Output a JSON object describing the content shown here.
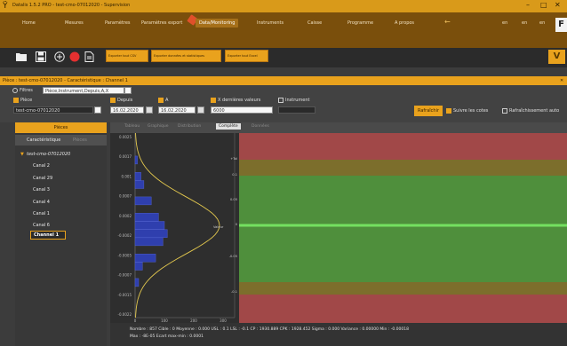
{
  "window": {
    "title": "Datalis 1.5.2 PRO - test-cmo-07012020 - Supervision",
    "minimize": "–",
    "maximize": "□",
    "close": "✕"
  },
  "menu": {
    "items": [
      "Home",
      "Mesures",
      "Paramètres",
      "Paramètres export",
      "Data/Monitoring",
      "Instruments",
      "Caisse",
      "Programme",
      "A propos"
    ],
    "active": "Data/Monitoring",
    "right_items": [
      "en",
      "en",
      "en"
    ],
    "arrow": "←",
    "fat_icon": "F"
  },
  "toolbar": {
    "export_buttons": [
      "Exporter tout CSV",
      "Exporter données et statistiques",
      "Exporter tout Excel"
    ],
    "corner_glyph": "V"
  },
  "panel": {
    "title": "Pièce : test-cmo-07012020 - Caractéristique : Channel 1",
    "close": "✕"
  },
  "filters": {
    "label": "Filtres",
    "value": "Pièce,Instrument,Depuis,A,X",
    "piece_label": "Pièce",
    "piece_value": "test-cmo-07012020",
    "depuis_label": "Depuis",
    "depuis_value": "16.02.2020",
    "a_label": "A",
    "a_value": "16.02.2020",
    "x_label": "X dernières valeurs",
    "x_value": "6000",
    "instrument_label": "Instrument",
    "refresh_label": "Rafraîchir",
    "follow_label": "Suivre les cotes",
    "auto_label": "Rafraîchissement auto"
  },
  "tree": {
    "tab_active": "Pièces",
    "subtab_active": "Caractéristique",
    "subtab_inactive": "Pièces",
    "root": "test-cmo-07012020",
    "items": [
      "Canal 2",
      "Canal 29",
      "Canal 3",
      "Canal 4",
      "Canal 1",
      "Canal 6"
    ],
    "selected": "Channel 1"
  },
  "view_tabs": {
    "items": [
      "Tableau",
      "Graphique",
      "Distribution",
      "Complète",
      "Données"
    ],
    "active": "Complète"
  },
  "chart_data": {
    "type": "histogram",
    "y_ticks": [
      "0.0025",
      "0.0017",
      "0.001",
      "0.0007",
      "0.0002",
      "-0.0002",
      "-0.0005",
      "-0.0007",
      "-0.0015",
      "-0.0022"
    ],
    "x_ticks": [
      "0",
      "100",
      "200",
      "300"
    ],
    "control_limits": [
      "+Tol",
      "0.1",
      "0.05",
      "0",
      "-0.05",
      "-0.1"
    ],
    "center_tag": "Valeur",
    "bins": [
      {
        "y": -0.0007,
        "count": 12
      },
      {
        "y": -0.0005,
        "count": 25
      },
      {
        "y": -0.0004,
        "count": 70
      },
      {
        "y": -0.0002,
        "count": 95
      },
      {
        "y": -0.0001,
        "count": 110
      },
      {
        "y": 0.0,
        "count": 100
      },
      {
        "y": 0.0001,
        "count": 80
      },
      {
        "y": 0.0003,
        "count": 55
      },
      {
        "y": 0.0005,
        "count": 30
      },
      {
        "y": 0.0006,
        "count": 20
      },
      {
        "y": 0.0008,
        "count": 8
      }
    ],
    "bands": {
      "colors": {
        "red": "#a14848",
        "olive": "#7c6e2c",
        "green": "#4f8f3c",
        "line": "#74e060"
      }
    }
  },
  "stats": {
    "line1": "Nombre : 857   Cible : 0   Moyenne : 0.000   USL : 0.1   LSL : -0.1   CP : 1930.889   CPK : 1928.452   Sigma : 0.000   Variance : 0.00000   Min : -0.00018",
    "line2": "Max : -8E-05   Ecart max-min : 0.0001"
  }
}
